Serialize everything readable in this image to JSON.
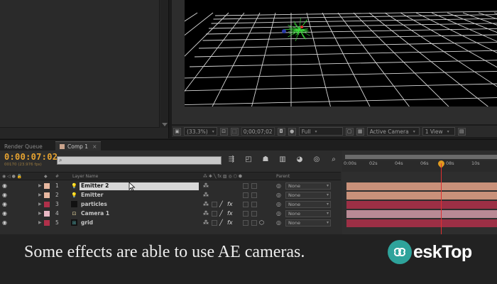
{
  "viewer": {
    "zoom": "(33.3%)",
    "timecode": "0;00;07;02",
    "quality": "Full",
    "camera": "Active Camera",
    "views": "1 View"
  },
  "tabs": {
    "render_queue": "Render Queue",
    "comp": "Comp 1"
  },
  "timeline": {
    "timecode": "0:00:07:02",
    "frames": "00170 (23.976 fps)",
    "columns": {
      "hash": "#",
      "layer_name": "Layer Name",
      "parent": "Parent"
    },
    "ruler": [
      "0:00s",
      "02s",
      "04s",
      "06s",
      "08s",
      "10s"
    ],
    "layers": [
      {
        "num": "1",
        "name": "Emitter 2",
        "label_color": "#e8b8a0",
        "icon": "light-icon",
        "parent": "None",
        "bar_color": "#c9917a",
        "selected": true
      },
      {
        "num": "2",
        "name": "Emitter",
        "label_color": "#e8b8a0",
        "icon": "light-icon",
        "parent": "None",
        "bar_color": "#c9917a",
        "selected": false
      },
      {
        "num": "3",
        "name": "particles",
        "label_color": "#b0304a",
        "icon": "solid-icon",
        "parent": "None",
        "bar_color": "#9c2f45",
        "selected": false
      },
      {
        "num": "4",
        "name": "Camera 1",
        "label_color": "#e8b8c4",
        "icon": "camera-icon",
        "parent": "None",
        "bar_color": "#b98a95",
        "selected": false
      },
      {
        "num": "5",
        "name": "grid",
        "label_color": "#b0304a",
        "icon": "precomp-icon",
        "parent": "None",
        "bar_color": "#9c2f45",
        "selected": false
      }
    ]
  },
  "subtitle": "Some effects are able to use AE cameras.",
  "logo": {
    "text": "eskTop",
    "accent": "#2ea39b"
  }
}
